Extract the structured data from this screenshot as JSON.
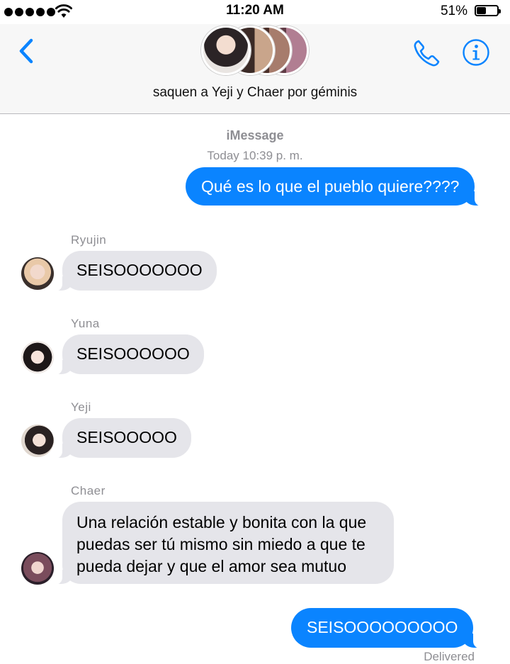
{
  "status_bar": {
    "time": "11:20 AM",
    "battery_percent": "51%",
    "battery_level": 0.51,
    "signal_icon": "signal-dots-icon",
    "wifi_icon": "wifi-icon"
  },
  "header": {
    "group_name": "saquen a Yeji y Chaer por géminis",
    "back_icon": "chevron-left-icon",
    "call_icon": "phone-icon",
    "info_icon": "info-icon",
    "accent_color": "#0a84ff"
  },
  "chat": {
    "service_label": "iMessage",
    "timestamp": "Today 10:39 p. m.",
    "messages": [
      {
        "direction": "outgoing",
        "text": "Qué es lo que el pueblo quiere????"
      },
      {
        "direction": "incoming",
        "sender": "Ryujin",
        "text": "SEISOOOOOOO"
      },
      {
        "direction": "incoming",
        "sender": "Yuna",
        "text": "SEISOOOOOO"
      },
      {
        "direction": "incoming",
        "sender": "Yeji",
        "text": "SEISOOOOO"
      },
      {
        "direction": "incoming",
        "sender": "Chaer",
        "lines": [
          "Una relación estable y bonita con la que",
          "puedas ser tú mismo sin miedo a que te",
          "pueda dejar y que el amor sea mutuo"
        ]
      },
      {
        "direction": "outgoing",
        "text": "SEISOOOOOOOOO"
      }
    ],
    "delivery_status": "Delivered"
  }
}
